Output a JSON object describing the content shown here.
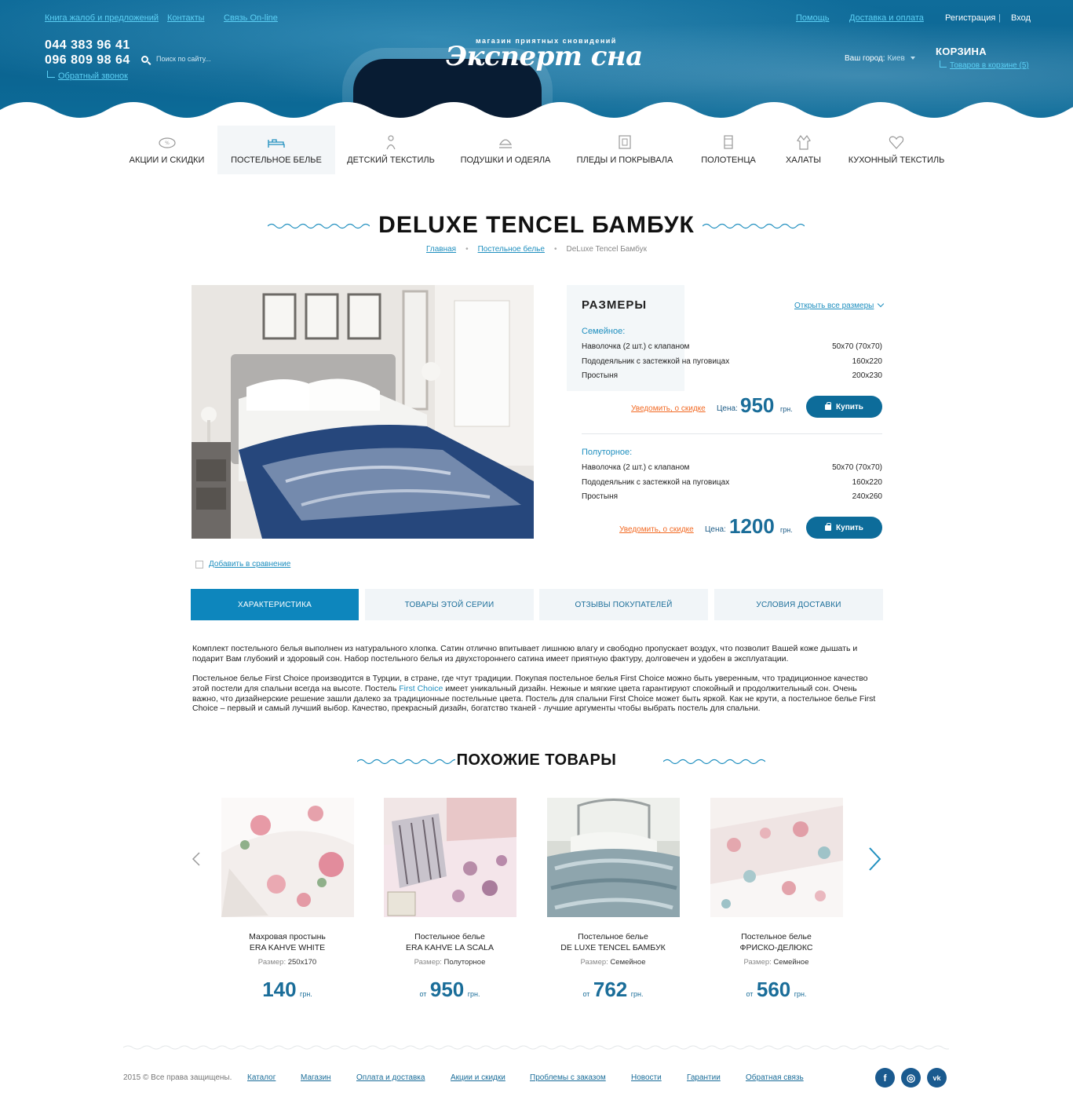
{
  "header": {
    "top_links_left": [
      "Книга жалоб и предложений",
      "Контакты",
      "Связь On-line"
    ],
    "top_links_right": [
      "Помощь",
      "Доставка и оплата"
    ],
    "register": "Регистрация",
    "separator": "|",
    "login": "Вход",
    "phones": [
      "044 383 96 41",
      "096 809 98 64"
    ],
    "callback": "Обратный звонок",
    "search_placeholder": "Поиск по сайту...",
    "logo_tagline": "магазин приятных сновидений",
    "logo_name": "Эксперт сна",
    "city_label": "Ваш город:",
    "city_value": "Киев",
    "cart_title": "КОРЗИНА",
    "cart_count": "Товаров в корзине (5)"
  },
  "nav": {
    "items": [
      {
        "label": "АКЦИИ И СКИДКИ",
        "icon": "discount-icon"
      },
      {
        "label": "ПОСТЕЛЬНОЕ БЕЛЬЕ",
        "icon": "bed-icon",
        "active": true
      },
      {
        "label": "ДЕТСКИЙ ТЕКСТИЛЬ",
        "icon": "child-icon"
      },
      {
        "label": "ПОДУШКИ И ОДЕЯЛА",
        "icon": "pillow-icon"
      },
      {
        "label": "ПЛЕДЫ И ПОКРЫВАЛА",
        "icon": "blanket-icon"
      },
      {
        "label": "ПОЛОТЕНЦА",
        "icon": "towel-icon"
      },
      {
        "label": "ХАЛАТЫ",
        "icon": "robe-icon"
      },
      {
        "label": "КУХОННЫЙ ТЕКСТИЛЬ",
        "icon": "kitchen-icon"
      }
    ]
  },
  "page": {
    "title": "DELUXE TENCEL БАМБУК",
    "breadcrumb": [
      "Главная",
      "Постельное белье",
      "DeLuxe Tencel Бамбук"
    ]
  },
  "product": {
    "sizes_title": "РАЗМЕРЫ",
    "open_all": "Открыть все размеры",
    "variants": [
      {
        "name": "Семейное:",
        "rows": [
          {
            "item": "Наволочка (2 шт.) с клапаном",
            "size": "50x70 (70x70)"
          },
          {
            "item": "Пододеяльник с застежкой на пуговицах",
            "size": "160x220"
          },
          {
            "item": "Простыня",
            "size": "200x230"
          }
        ],
        "notify": "Уведомить, о скидке",
        "price_label": "Цена:",
        "price": "950",
        "currency": "грн.",
        "buy": "Купить"
      },
      {
        "name": "Полуторное:",
        "rows": [
          {
            "item": "Наволочка (2 шт.) с клапаном",
            "size": "50x70 (70x70)"
          },
          {
            "item": "Пододеяльник с застежкой на пуговицах",
            "size": "160x220"
          },
          {
            "item": "Простыня",
            "size": "240x260"
          }
        ],
        "notify": "Уведомить, о скидке",
        "price_label": "Цена:",
        "price": "1200",
        "currency": "грн.",
        "buy": "Купить"
      }
    ],
    "compare": "Добавить в сравнение"
  },
  "tabs": [
    "ХАРАКТЕРИСТИКА",
    "ТОВАРЫ ЭТОЙ СЕРИИ",
    "ОТЗЫВЫ ПОКУПАТЕЛЕЙ",
    "УСЛОВИЯ ДОСТАВКИ"
  ],
  "description": {
    "p1": "Комплект постельного белья выполнен из натурального хлопка. Сатин отлично впитывает лишнюю влагу и свободно пропускает воздух, что позволит Вашей коже дышать и подарит Вам глубокий и здоровый сон. Набор постельного белья из двухстороннего сатина имеет приятную фактуру, долговечен и удобен в эксплуатации.",
    "p2_a": "Постельное белье First Choice производится в Турции, в стране, где чтут традиции. Покупая постельное белья First Choice можно быть уверенным, что традиционное качество этой постели для спальни всегда на высоте. Постель ",
    "p2_link": "First Choice",
    "p2_b": " имеет уникальный дизайн. Нежные и мягкие цвета гарантируют спокойный и продолжительный сон. Очень важно, что дизайнерские решение зашли далеко за традиционные постельные цвета. Постель для спальни First Choice может быть яркой. Как не крути, а постельное белье First Choice – первый и самый лучший выбор. Качество, прекрасный дизайн, богатство тканей - лучшие аргументы чтобы выбрать постель для спальни."
  },
  "similar": {
    "title": "ПОХОЖИЕ ТОВАРЫ",
    "size_key": "Размер:",
    "items": [
      {
        "line1": "Махровая простынь",
        "line2": "ERA KAHVE WHITE",
        "size": "250x170",
        "from": "",
        "price": "140",
        "currency": "грн."
      },
      {
        "line1": "Постельное белье",
        "line2": "ERA KAHVE LA SCALA",
        "size": "Полуторное",
        "from": "от",
        "price": "950",
        "currency": "грн."
      },
      {
        "line1": "Постельное белье",
        "line2": "DE LUXE TENCEL БАМБУК",
        "size": "Семейное",
        "from": "от",
        "price": "762",
        "currency": "грн."
      },
      {
        "line1": "Постельное белье",
        "line2": "ФРИСКО-ДЕЛЮКС",
        "size": "Семейное",
        "from": "от",
        "price": "560",
        "currency": "грн."
      }
    ]
  },
  "footer": {
    "copyright": "2015 © Все права защищены.",
    "links": [
      "Каталог",
      "Магазин",
      "Оплата и доставка",
      "Акции и скидки",
      "Проблемы с заказом",
      "Новости",
      "Гарантии",
      "Обратная связь"
    ],
    "social": [
      "f",
      "◎",
      "vk"
    ]
  },
  "colors": {
    "brand": "#0d6c9a",
    "accent": "#1f8fbf",
    "notify": "#f26a24"
  }
}
